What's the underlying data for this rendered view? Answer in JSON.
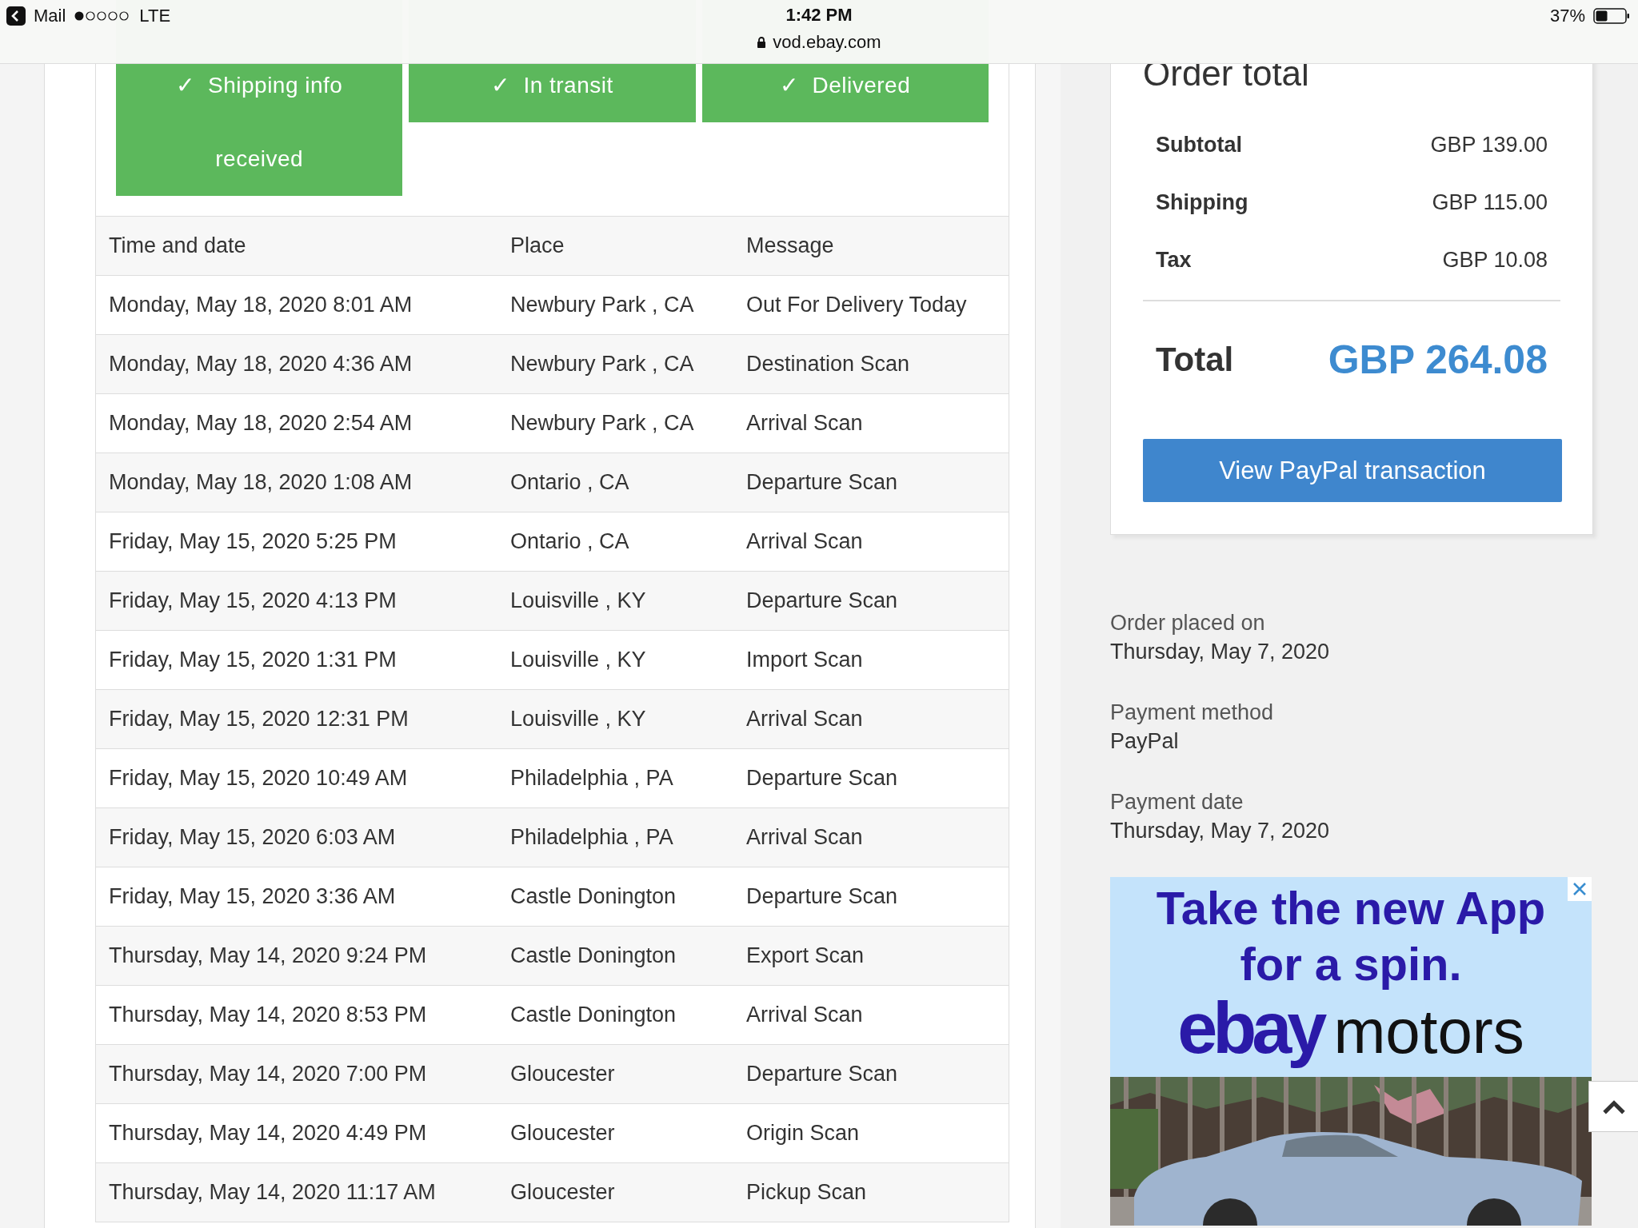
{
  "status_bar": {
    "back_label": "Mail",
    "network": "LTE",
    "time": "1:42 PM",
    "url": "vod.ebay.com",
    "battery": "37%"
  },
  "progress_steps": [
    {
      "icon": "✓",
      "label": "Shipping info received",
      "done": true
    },
    {
      "icon": "✓",
      "label": "In transit",
      "done": true
    },
    {
      "icon": "✓",
      "label": "Delivered",
      "done": true
    }
  ],
  "table": {
    "columns": [
      "Time and date",
      "Place",
      "Message"
    ],
    "rows": [
      [
        "Monday, May 18, 2020 8:01 AM",
        "Newbury Park , CA",
        "Out For Delivery Today"
      ],
      [
        "Monday, May 18, 2020 4:36 AM",
        "Newbury Park , CA",
        "Destination Scan"
      ],
      [
        "Monday, May 18, 2020 2:54 AM",
        "Newbury Park , CA",
        "Arrival Scan"
      ],
      [
        "Monday, May 18, 2020 1:08 AM",
        "Ontario , CA",
        "Departure Scan"
      ],
      [
        "Friday, May 15, 2020 5:25 PM",
        "Ontario , CA",
        "Arrival Scan"
      ],
      [
        "Friday, May 15, 2020 4:13 PM",
        "Louisville , KY",
        "Departure Scan"
      ],
      [
        "Friday, May 15, 2020 1:31 PM",
        "Louisville , KY",
        "Import Scan"
      ],
      [
        "Friday, May 15, 2020 12:31 PM",
        "Louisville , KY",
        "Arrival Scan"
      ],
      [
        "Friday, May 15, 2020 10:49 AM",
        "Philadelphia , PA",
        "Departure Scan"
      ],
      [
        "Friday, May 15, 2020 6:03 AM",
        "Philadelphia , PA",
        "Arrival Scan"
      ],
      [
        "Friday, May 15, 2020 3:36 AM",
        "Castle Donington",
        "Departure Scan"
      ],
      [
        "Thursday, May 14, 2020 9:24 PM",
        "Castle Donington",
        "Export Scan"
      ],
      [
        "Thursday, May 14, 2020 8:53 PM",
        "Castle Donington",
        "Arrival Scan"
      ],
      [
        "Thursday, May 14, 2020 7:00 PM",
        "Gloucester",
        "Departure Scan"
      ],
      [
        "Thursday, May 14, 2020 4:49 PM",
        "Gloucester",
        "Origin Scan"
      ],
      [
        "Thursday, May 14, 2020 11:17 AM",
        "Gloucester",
        "Pickup Scan"
      ]
    ]
  },
  "order_total": {
    "title": "Order total",
    "lines": [
      {
        "label": "Subtotal",
        "value": "GBP 139.00"
      },
      {
        "label": "Shipping",
        "value": "GBP 115.00"
      },
      {
        "label": "Tax",
        "value": "GBP 10.08"
      }
    ],
    "total_label": "Total",
    "total_value": "GBP 264.08",
    "button": "View PayPal transaction"
  },
  "order_info": [
    {
      "label": "Order placed on",
      "value": "Thursday, May 7, 2020"
    },
    {
      "label": "Payment method",
      "value": "PayPal"
    },
    {
      "label": "Payment date",
      "value": "Thursday, May 7, 2020"
    }
  ],
  "ad": {
    "headline_lines": [
      "Take the new App",
      "for a spin."
    ],
    "brand": "ebay",
    "brand_suffix": "motors",
    "kind": "picture"
  }
}
